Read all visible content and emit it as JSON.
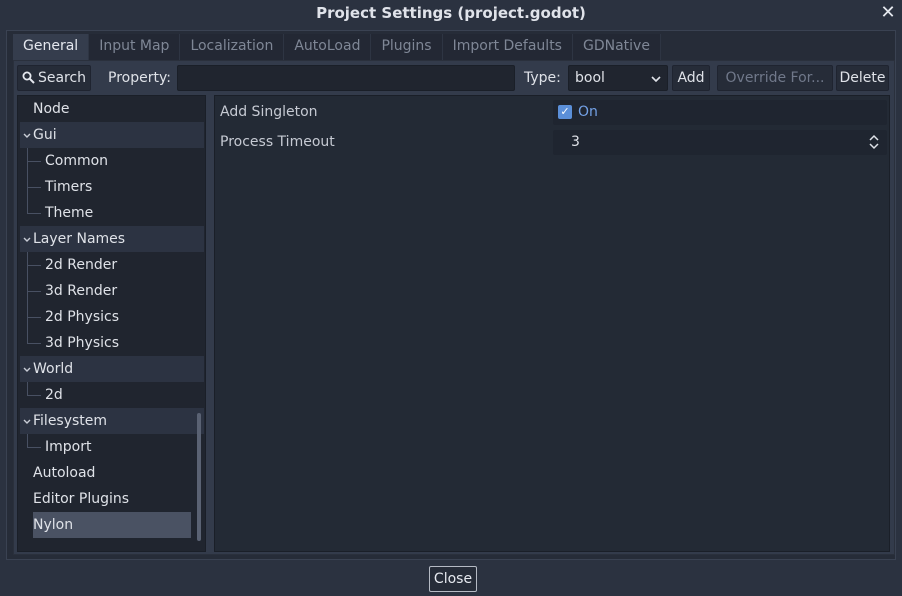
{
  "window": {
    "title": "Project Settings (project.godot)",
    "close_icon": "✕"
  },
  "tabs": [
    {
      "label": "General"
    },
    {
      "label": "Input Map"
    },
    {
      "label": "Localization"
    },
    {
      "label": "AutoLoad"
    },
    {
      "label": "Plugins"
    },
    {
      "label": "Import Defaults"
    },
    {
      "label": "GDNative"
    }
  ],
  "toolbar": {
    "search_label": "Search",
    "property_label": "Property:",
    "property_value": "",
    "type_label": "Type:",
    "type_value": "bool",
    "add_label": "Add",
    "override_label": "Override For...",
    "delete_label": "Delete"
  },
  "tree": {
    "items": [
      {
        "label": "Node"
      },
      {
        "label": "Gui"
      },
      {
        "label": "Common"
      },
      {
        "label": "Timers"
      },
      {
        "label": "Theme"
      },
      {
        "label": "Layer Names"
      },
      {
        "label": "2d Render"
      },
      {
        "label": "3d Render"
      },
      {
        "label": "2d Physics"
      },
      {
        "label": "3d Physics"
      },
      {
        "label": "World"
      },
      {
        "label": "2d"
      },
      {
        "label": "Filesystem"
      },
      {
        "label": "Import"
      },
      {
        "label": "Autoload"
      },
      {
        "label": "Editor Plugins"
      },
      {
        "label": "Nylon"
      }
    ]
  },
  "properties": {
    "add_singleton": {
      "label": "Add Singleton",
      "value_text": "On",
      "checked": true
    },
    "process_timeout": {
      "label": "Process Timeout",
      "value": "3"
    }
  },
  "footer": {
    "close_label": "Close"
  },
  "colors": {
    "accent": "#5b8fd8",
    "background": "#2b3240",
    "panel": "#333b4b"
  }
}
